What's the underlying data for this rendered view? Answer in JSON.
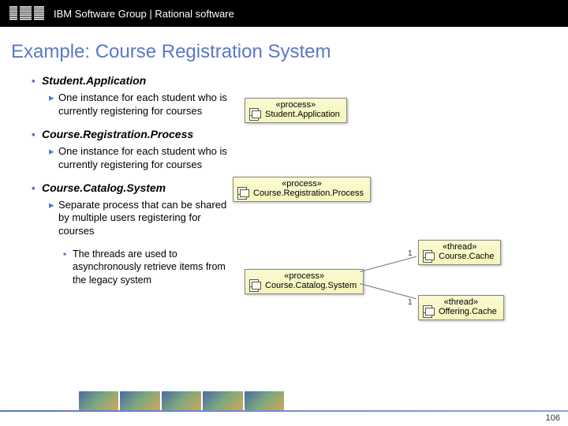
{
  "header": {
    "logo_alt": "IBM",
    "breadcrumb": "IBM Software Group | Rational software"
  },
  "title": "Example: Course Registration System",
  "sections": [
    {
      "heading": "Student.Application",
      "points": [
        "One instance for each student who is currently registering for courses"
      ]
    },
    {
      "heading": "Course.Registration.Process",
      "points": [
        "One instance for each student who is currently registering for courses"
      ]
    },
    {
      "heading": "Course.Catalog.System",
      "points": [
        "Separate process that can be shared by multiple users registering for courses"
      ],
      "subpoints": [
        "The threads are used to asynchronously retrieve items from the legacy system"
      ]
    }
  ],
  "uml": {
    "box1": {
      "stereo": "«process»",
      "name": "Student.Application"
    },
    "box2": {
      "stereo": "«process»",
      "name": "Course.Registration.Process"
    },
    "box3": {
      "stereo": "«process»",
      "name": "Course.Catalog.System"
    },
    "box4": {
      "stereo": "«thread»",
      "name": "Course.Cache"
    },
    "box5": {
      "stereo": "«thread»",
      "name": "Offering.Cache"
    },
    "mult1": "1",
    "mult2": "1"
  },
  "page_number": "106"
}
